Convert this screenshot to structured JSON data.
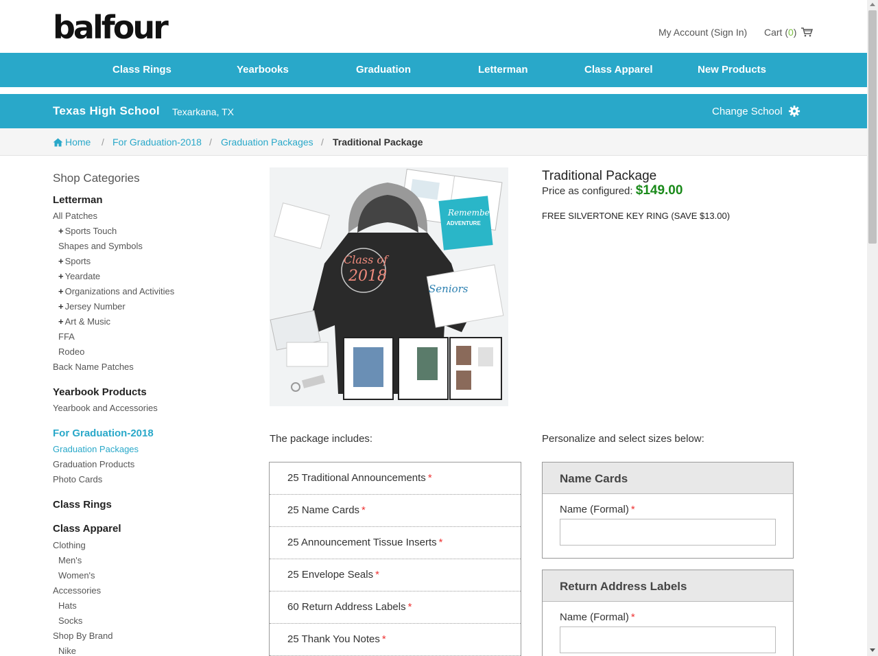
{
  "header": {
    "logo": "balfour",
    "account": "My Account (Sign In)",
    "cart_label": "Cart (",
    "cart_count": "0",
    "cart_close": ")"
  },
  "nav": [
    "Class Rings",
    "Yearbooks",
    "Graduation",
    "Letterman",
    "Class Apparel",
    "New Products"
  ],
  "school": {
    "name": "Texas High School",
    "location": "Texarkana, TX",
    "change": "Change School"
  },
  "breadcrumb": [
    "Home",
    "For Graduation-2018",
    "Graduation Packages",
    "Traditional Package"
  ],
  "sidebar": {
    "title": "Shop Categories",
    "letterman": {
      "heading": "Letterman",
      "items": [
        "All Patches",
        "Sports Touch",
        "Shapes and Symbols",
        "Sports",
        "Yeardate",
        "Organizations and Activities",
        "Jersey Number",
        "Art & Music",
        "FFA",
        "Rodeo",
        "Back Name Patches"
      ]
    },
    "yearbook": {
      "heading": "Yearbook Products",
      "items": [
        "Yearbook and Accessories"
      ]
    },
    "graduation": {
      "heading": "For Graduation-2018",
      "items": [
        "Graduation Packages",
        "Graduation Products",
        "Photo Cards"
      ]
    },
    "rings": {
      "heading": "Class Rings"
    },
    "apparel": {
      "heading": "Class Apparel",
      "items": [
        "Clothing",
        "Men's",
        "Women's",
        "Accessories",
        "Hats",
        "Socks",
        "Shop By Brand",
        "Nike"
      ]
    }
  },
  "product": {
    "title": "Traditional Package",
    "price_label": "Price as configured: ",
    "price": "$149.00",
    "promo": "FREE SILVERTONE KEY RING (SAVE $13.00)",
    "includes_title": "The package includes:",
    "personalize_title": "Personalize and select sizes below:",
    "includes": [
      "25 Traditional Announcements",
      "25 Name Cards",
      "25 Announcement Tissue Inserts",
      "25 Envelope Seals",
      "60 Return Address Labels",
      "25 Thank You Notes"
    ],
    "required_mark": "*",
    "image_text": {
      "class_of": "Class of",
      "year": "2018",
      "remember": "Remember",
      "adventure": "ADVENTURE",
      "seniors": "Seniors"
    }
  },
  "personalize": [
    {
      "heading": "Name Cards",
      "label": "Name (Formal)"
    },
    {
      "heading": "Return Address Labels",
      "label": "Name (Formal)"
    }
  ],
  "colors": {
    "brand": "#29a8c9",
    "price": "#1a8a1a",
    "required": "#ee3333",
    "cart_count": "#7cc242"
  }
}
